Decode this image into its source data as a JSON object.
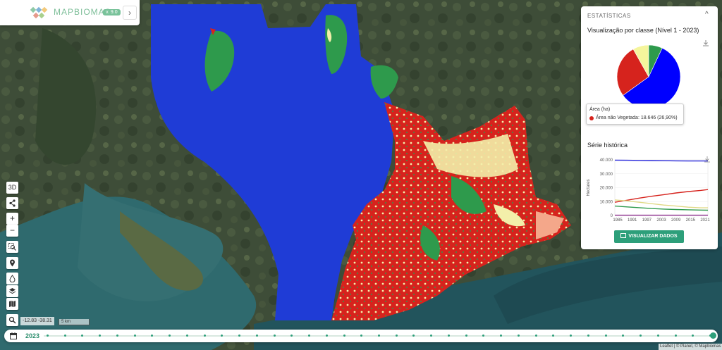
{
  "brand": {
    "name": "MAPBIOMAS",
    "version": "v. 9.0",
    "toggle": "›"
  },
  "controls": {
    "three_d": "3D",
    "zoom_in": "+",
    "zoom_out": "−"
  },
  "coordinates": "-12.83  -38.31",
  "scale": "5 km",
  "timeline": {
    "year": "2023",
    "ticks": 39
  },
  "stats": {
    "header": "ESTATÍSTICAS",
    "collapse": "^",
    "class_title": "Visualização por classe (Nível 1 - 2023)",
    "tooltip_title": "Área (ha)",
    "tooltip_value": "Área não Vegetada: 18.646 (26,90%)",
    "series_title": "Série histórica",
    "button": "VISUALIZAR DADOS"
  },
  "colors": {
    "water": "#1f3cd6",
    "nonveg": "#d6231d",
    "forest": "#2e9a4c",
    "agro": "#f3efaa",
    "accent": "#2d9f7a"
  },
  "chart_data": [
    {
      "type": "pie",
      "title": "Visualização por classe (Nível 1 - 2023)",
      "slices": [
        {
          "name": "",
          "value": 0.58,
          "color": "#0000ff"
        },
        {
          "name": "Área não Vegetada",
          "value": 0.269,
          "color": "#d6231d"
        },
        {
          "name": "",
          "value": 0.081,
          "color": "#f5f59c"
        },
        {
          "name": "",
          "value": 0.07,
          "color": "#2e9a4c"
        }
      ]
    },
    {
      "type": "line",
      "title": "Série histórica",
      "ylabel": "Hectares",
      "x_ticks": [
        "1985",
        "1991",
        "1997",
        "2003",
        "2009",
        "2015",
        "2021"
      ],
      "y_ticks": [
        "40.000",
        "30.000",
        "20.000",
        "10.000",
        "0"
      ],
      "ylim": [
        0,
        40000
      ],
      "x": [
        1985,
        1990,
        1995,
        2000,
        2005,
        2010,
        2015,
        2020,
        2023
      ],
      "series": [
        {
          "color": "#2b2bdc",
          "values": [
            39800,
            39700,
            39600,
            39500,
            39400,
            39300,
            39200,
            39200,
            39200
          ]
        },
        {
          "color": "#d6231d",
          "values": [
            9500,
            11000,
            12500,
            13800,
            15000,
            16200,
            17200,
            18000,
            18646
          ]
        },
        {
          "color": "#e0d986",
          "values": [
            11200,
            10500,
            9500,
            8500,
            7500,
            6800,
            6000,
            5500,
            5500
          ]
        },
        {
          "color": "#2e9a4c",
          "values": [
            6800,
            6200,
            5600,
            5000,
            4600,
            4300,
            4100,
            3900,
            3800
          ]
        },
        {
          "color": "#8b2a8b",
          "values": [
            200,
            200,
            200,
            200,
            200,
            200,
            200,
            200,
            200
          ]
        }
      ]
    }
  ],
  "attribution": "Leaflet | © Planet, © Mapbiomas"
}
